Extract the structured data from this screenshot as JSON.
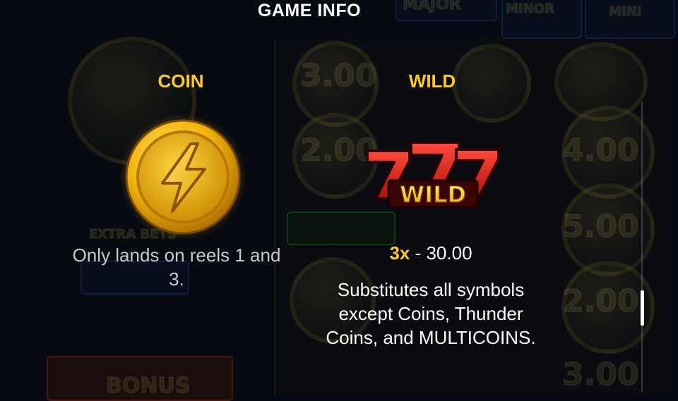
{
  "title": "GAME INFO",
  "background": {
    "texts": [
      "MAJOR",
      "MINOR",
      "MINI",
      "3.00",
      "2.00",
      "4.00",
      "5.00",
      "2.00",
      "3.00",
      "EXTRA BETS",
      "BONUS"
    ]
  },
  "symbols": [
    {
      "name": "COIN",
      "description": "Only lands on reels 1 and 3.",
      "icon": "lightning-coin-icon"
    },
    {
      "name": "WILD",
      "multiplier": "3x",
      "payout": "- 30.00",
      "description": "Substitutes all symbols except Coins, Thunder Coins, and MULTICOINS.",
      "icon": "777-wild-icon",
      "logo_text": "WILD"
    }
  ],
  "colors": {
    "heading": "#ffc82a",
    "background": "#070a10",
    "coin_gold": "#f2b50e",
    "seven_red": "#e0231c"
  }
}
